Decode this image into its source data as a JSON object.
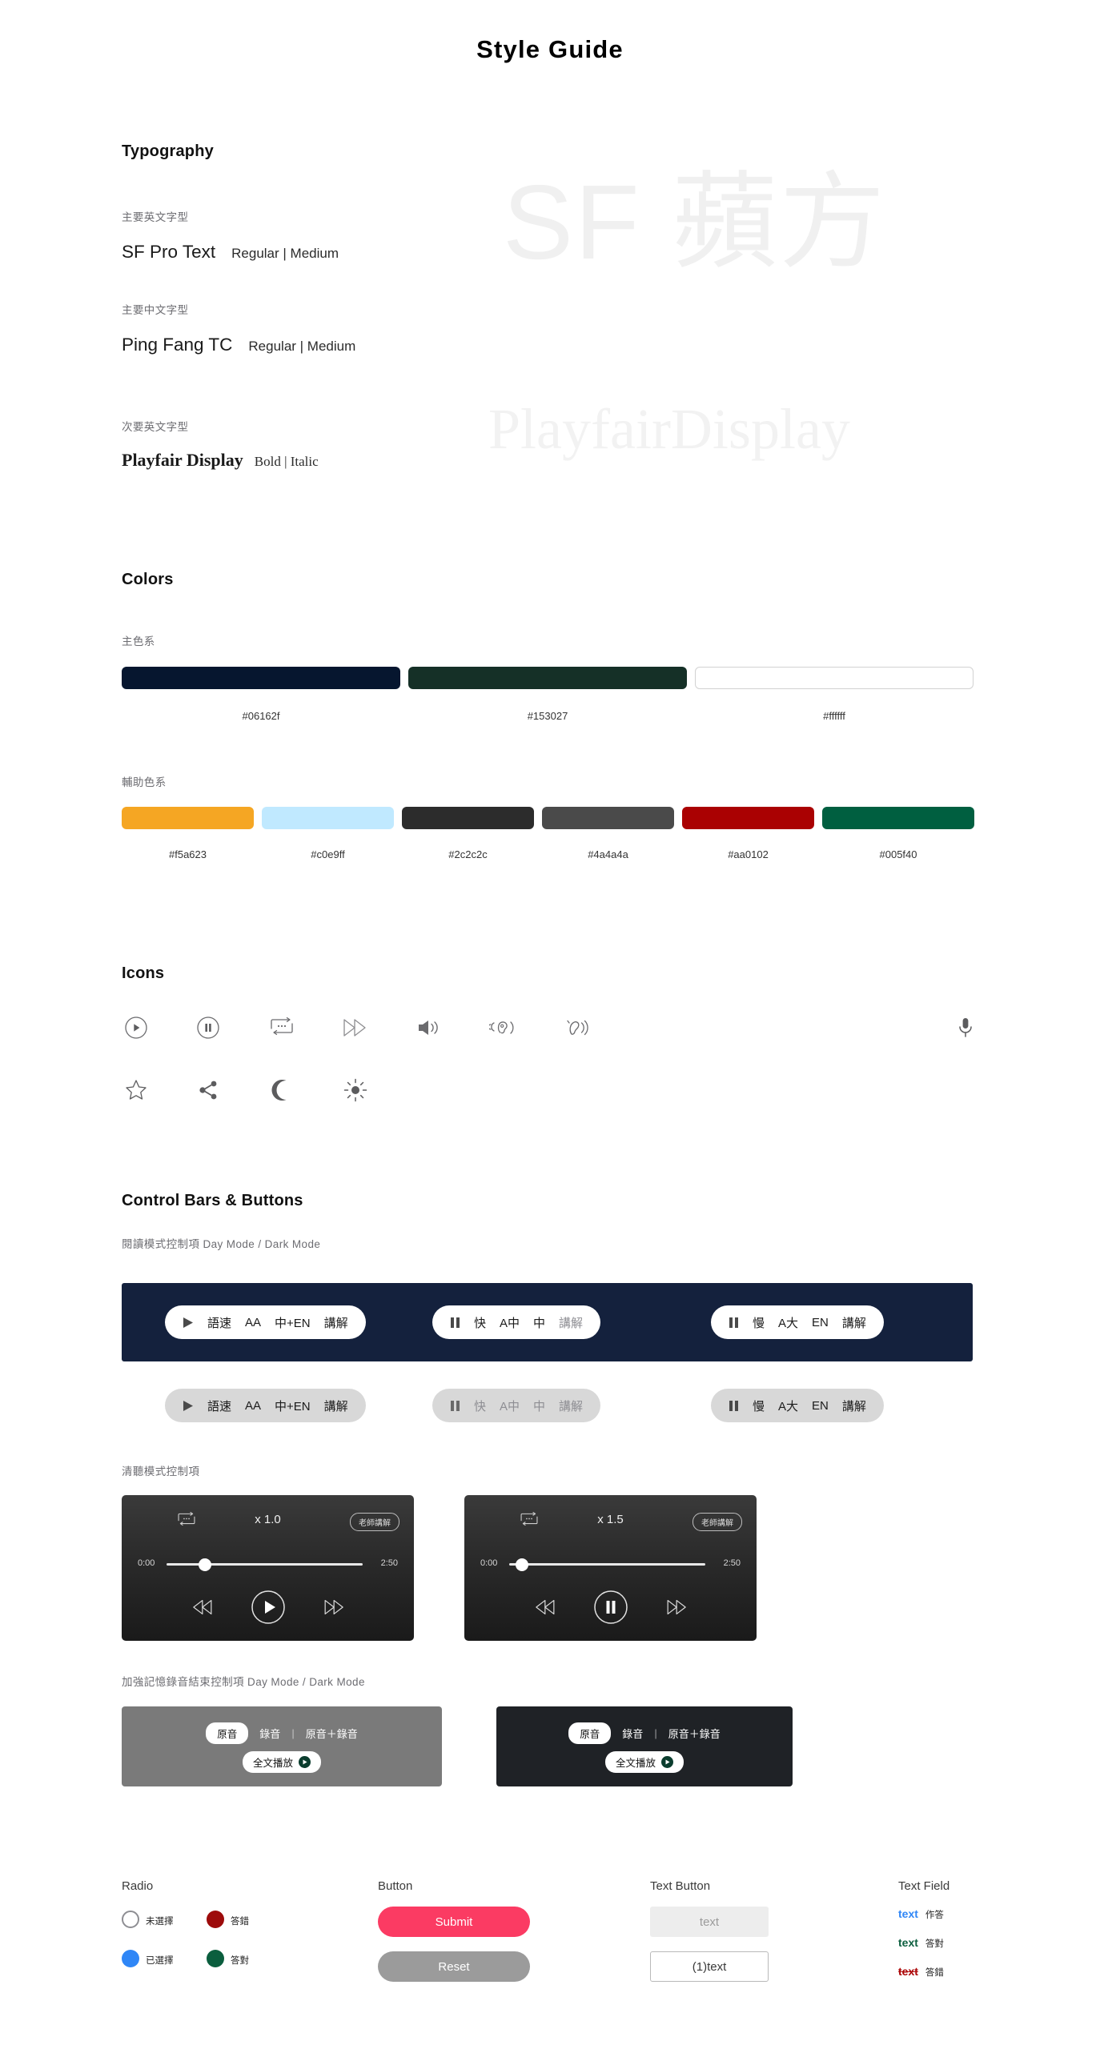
{
  "doc": {
    "title": "Style Guide"
  },
  "typography": {
    "heading": "Typography",
    "watermark_primary": "SF 蘋方",
    "watermark_secondary": "PlayfairDisplay",
    "rows": [
      {
        "label": "主要英文字型",
        "face": "SF Pro Text",
        "weights": "Regular | Medium"
      },
      {
        "label": "主要中文字型",
        "face": "Ping Fang TC",
        "weights": "Regular | Medium"
      },
      {
        "label": "次要英文字型",
        "face": "Playfair Display",
        "weights": "Bold | Italic"
      }
    ]
  },
  "colors": {
    "heading": "Colors",
    "primary_label": "主色系",
    "primary": [
      {
        "hex": "#06162f",
        "caption": "#06162f"
      },
      {
        "hex": "#153027",
        "caption": "#153027"
      },
      {
        "hex": "#ffffff",
        "caption": "#ffffff"
      }
    ],
    "secondary_label": "輔助色系",
    "secondary": [
      {
        "hex": "#f5a623",
        "caption": "#f5a623"
      },
      {
        "hex": "#c0e9ff",
        "caption": "#c0e9ff"
      },
      {
        "hex": "#2c2c2c",
        "caption": "#2c2c2c"
      },
      {
        "hex": "#4a4a4a",
        "caption": "#4a4a4a"
      },
      {
        "hex": "#aa0102",
        "caption": "#aa0102"
      },
      {
        "hex": "#005f40",
        "caption": "#005f40"
      }
    ]
  },
  "icons": {
    "heading": "Icons",
    "row1": [
      "play-circle-icon",
      "pause-circle-icon",
      "repeat-icon",
      "fast-forward-icon",
      "speaker-icon",
      "ear-listen-icon",
      "head-speak-icon",
      "microphone-icon"
    ],
    "row2": [
      "star-icon",
      "share-icon",
      "moon-icon",
      "sun-icon"
    ]
  },
  "controls": {
    "heading": "Control Bars & Buttons",
    "reading_label": "閱讀模式控制項 Day Mode / Dark Mode",
    "bars": [
      {
        "icon": "play-icon",
        "speed": "語速",
        "size": "AA",
        "lang": "中+EN",
        "note": "講解"
      },
      {
        "icon": "pause-icon",
        "speed": "快",
        "size": "A中",
        "lang": "中",
        "note": "講解"
      },
      {
        "icon": "pause-icon",
        "speed": "慢",
        "size": "A大",
        "lang": "EN",
        "note": "講解"
      }
    ],
    "listening_label": "清聽模式控制項",
    "players": [
      {
        "speed": "x 1.0",
        "chip": "老師講解",
        "start": "0:00",
        "end": "2:50",
        "state": "play-icon"
      },
      {
        "speed": "x 1.5",
        "chip": "老師講解",
        "start": "0:00",
        "end": "2:50",
        "state": "pause-icon"
      }
    ],
    "record_label": "加強記憶錄音結束控制項 Day Mode / Dark Mode",
    "records": [
      {
        "bg": "#7a7a7a",
        "chip": "原音",
        "opt2": "錄音",
        "opt3": "原音＋錄音",
        "playall": "全文播放"
      },
      {
        "bg": "#1f2226",
        "chip": "原音",
        "opt2": "錄音",
        "opt3": "原音＋錄音",
        "playall": "全文播放"
      }
    ]
  },
  "forms": {
    "radio": {
      "heading": "Radio",
      "items": [
        {
          "label": "未選擇",
          "color": "#ffffff",
          "border": "#8e8e93"
        },
        {
          "label": "已選擇",
          "color": "#2f86f6",
          "border": "#2f86f6"
        },
        {
          "label": "答錯",
          "color": "#9d0b0b",
          "border": "#9d0b0b"
        },
        {
          "label": "答對",
          "color": "#0b5e3e",
          "border": "#0b5e3e"
        }
      ]
    },
    "button": {
      "heading": "Button",
      "submit": "Submit",
      "submit_color": "#fb3b63",
      "reset": "Reset",
      "reset_color": "#9b9b9b"
    },
    "text_button": {
      "heading": "Text Button",
      "filled": "text",
      "outlined": "(1)text"
    },
    "text_field": {
      "heading": "Text Field",
      "rows": [
        {
          "text": "text",
          "color": "#2f86f6",
          "note": "作答",
          "strike": false
        },
        {
          "text": "text",
          "color": "#0b5e3e",
          "note": "答對",
          "strike": false
        },
        {
          "text": "text",
          "color": "#aa0102",
          "note": "答錯",
          "strike": true
        }
      ]
    }
  }
}
